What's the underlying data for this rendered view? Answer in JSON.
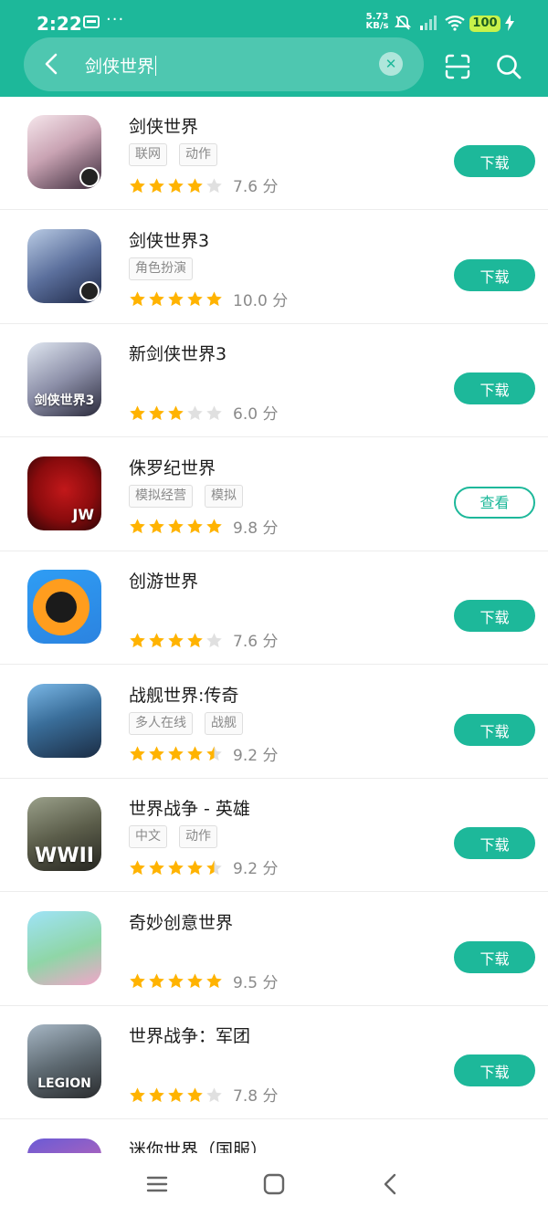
{
  "status_bar": {
    "time": "2:22",
    "dots": "···",
    "speed_value": "5.73",
    "speed_unit": "KB/s",
    "battery": "100"
  },
  "search": {
    "query": "剑侠世界"
  },
  "colors": {
    "brand": "#1db89a",
    "star_on": "#ffb300",
    "star_off": "#e0e0e0"
  },
  "apps": [
    {
      "name": "剑侠世界",
      "tags": [
        "联网",
        "动作"
      ],
      "rating": 4,
      "score": "7.6 分",
      "action": "下载"
    },
    {
      "name": "剑侠世界3",
      "tags": [
        "角色扮演"
      ],
      "rating": 5,
      "score": "10.0 分",
      "action": "下载"
    },
    {
      "name": "新剑侠世界3",
      "tags": [],
      "rating": 3,
      "score": "6.0 分",
      "action": "下载"
    },
    {
      "name": "侏罗纪世界",
      "tags": [
        "模拟经营",
        "模拟"
      ],
      "rating": 5,
      "score": "9.8 分",
      "action": "查看"
    },
    {
      "name": "创游世界",
      "tags": [],
      "rating": 4,
      "score": "7.6 分",
      "action": "下载"
    },
    {
      "name": "战舰世界:传奇",
      "tags": [
        "多人在线",
        "战舰"
      ],
      "rating": 4.5,
      "score": "9.2 分",
      "action": "下载"
    },
    {
      "name": "世界战争 - 英雄",
      "tags": [
        "中文",
        "动作"
      ],
      "rating": 4.5,
      "score": "9.2 分",
      "action": "下载"
    },
    {
      "name": "奇妙创意世界",
      "tags": [],
      "rating": 5,
      "score": "9.5 分",
      "action": "下载"
    },
    {
      "name": "世界战争：军团",
      "tags": [],
      "rating": 4,
      "score": "7.8 分",
      "action": "下载"
    },
    {
      "name": "迷你世界（国服）",
      "tags": [],
      "rating": 0,
      "score": "",
      "action": ""
    }
  ],
  "icon_art": [
    {
      "glyph": "",
      "badge": true
    },
    {
      "glyph": "",
      "badge": true
    },
    {
      "glyph": "剑侠世界3",
      "badge": false
    },
    {
      "glyph": "JW",
      "badge": false
    },
    {
      "glyph": "",
      "badge": false
    },
    {
      "glyph": "",
      "badge": false
    },
    {
      "glyph": "WWII",
      "badge": false
    },
    {
      "glyph": "",
      "badge": false
    },
    {
      "glyph": "LEGION",
      "badge": false
    },
    {
      "glyph": "",
      "badge": false
    }
  ]
}
